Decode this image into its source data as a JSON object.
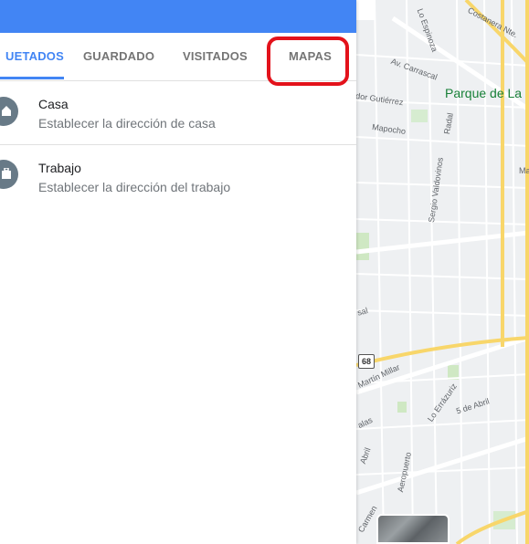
{
  "tabs": [
    {
      "label": "UETADOS",
      "active": true
    },
    {
      "label": "GUARDADO",
      "active": false
    },
    {
      "label": "VISITADOS",
      "active": false
    },
    {
      "label": "MAPAS",
      "active": false
    }
  ],
  "items": [
    {
      "title": "Casa",
      "subtitle": "Establecer la dirección de casa",
      "icon": "home-icon"
    },
    {
      "title": "Trabajo",
      "subtitle": "Establecer la dirección del trabajo",
      "icon": "briefcase-icon"
    }
  ],
  "map": {
    "park": "Parque de La",
    "streets": [
      "Costanera Nte.",
      "Lo Espinoza",
      "Av. Carrascal",
      "dor Gutiérrez",
      "Mapocho",
      "Radal",
      "Sergio Valdovinos",
      "Ma",
      "sal",
      "Martín Millar",
      "5 de Abril",
      "Lo Errázuriz",
      "alas",
      "Aeropuerto",
      "Abril",
      "Carmen"
    ],
    "route_shield": "68"
  },
  "colors": {
    "accent": "#4285f4",
    "highlight": "#e3121b",
    "park": "#188038"
  }
}
